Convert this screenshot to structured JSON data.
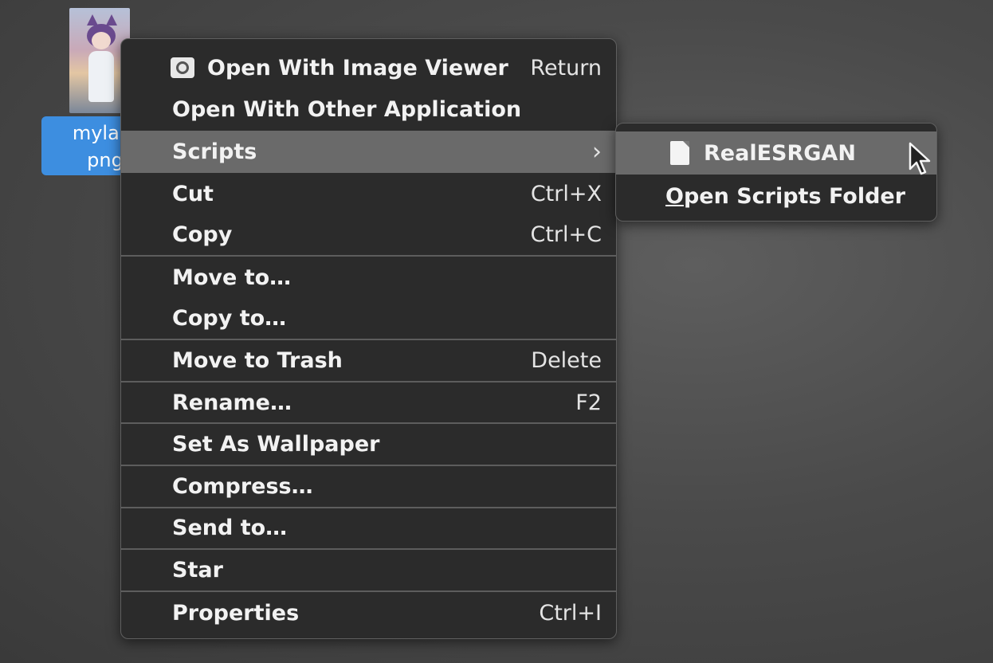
{
  "desktop_file": {
    "name_line1": "mylam",
    "name_line2": "png"
  },
  "context_menu": {
    "items": [
      {
        "label": "Open With Image Viewer",
        "accel": "Return",
        "icon": "image-viewer-icon"
      },
      {
        "label": "Open With Other Application",
        "accel": ""
      },
      {
        "label": "Scripts",
        "accel": "",
        "submenu": true
      },
      {
        "label": "Cut",
        "accel": "Ctrl+X"
      },
      {
        "label": "Copy",
        "accel": "Ctrl+C"
      },
      {
        "label": "Move to…",
        "accel": ""
      },
      {
        "label": "Copy to…",
        "accel": ""
      },
      {
        "label": "Move to Trash",
        "accel": "Delete"
      },
      {
        "label": "Rename…",
        "accel": "F2"
      },
      {
        "label": "Set As Wallpaper",
        "accel": ""
      },
      {
        "label": "Compress…",
        "accel": ""
      },
      {
        "label": "Send to…",
        "accel": ""
      },
      {
        "label": "Star",
        "accel": ""
      },
      {
        "label": "Properties",
        "accel": "Ctrl+I"
      }
    ]
  },
  "scripts_submenu": {
    "items": [
      {
        "label": "RealESRGAN",
        "icon": "document-icon"
      },
      {
        "label": "Open Scripts Folder"
      }
    ]
  },
  "colors": {
    "menu_bg": "#2b2b2b",
    "highlight": "#6a6a6a",
    "selection_blue": "#3d8ee0"
  }
}
